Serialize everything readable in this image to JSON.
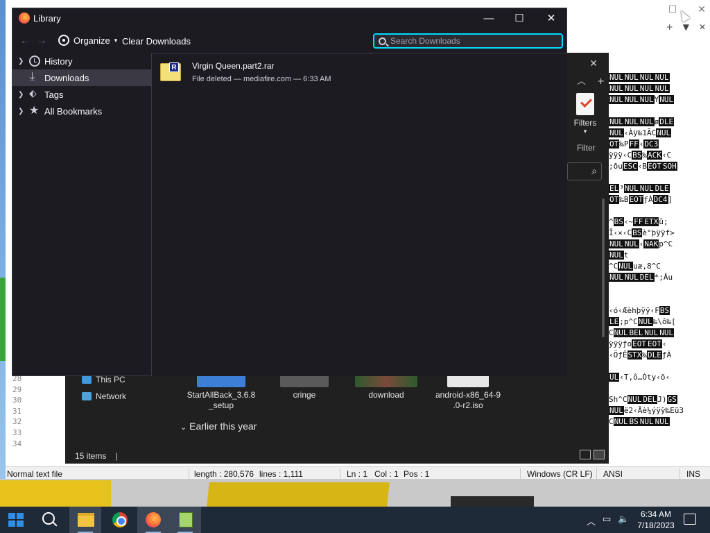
{
  "library": {
    "title": "Library",
    "organize_label": "Organize",
    "clear_downloads_label": "Clear Downloads",
    "search_placeholder": "Search Downloads",
    "sidebar": [
      {
        "label": "History",
        "expandable": true,
        "icon": "clock-icon"
      },
      {
        "label": "Downloads",
        "expandable": false,
        "icon": "download-icon",
        "selected": true
      },
      {
        "label": "Tags",
        "expandable": true,
        "icon": "tag-icon"
      },
      {
        "label": "All Bookmarks",
        "expandable": true,
        "icon": "star-icon"
      }
    ],
    "downloads": [
      {
        "name": "Virgin Queen.part2.rar",
        "status": "File deleted — mediafire.com — 6:33 AM",
        "icon": "rar-archive-icon"
      }
    ]
  },
  "explorer": {
    "filters_label": "Filters",
    "filter_label": "Filter",
    "nav": [
      {
        "label": "This PC",
        "icon": "computer-icon"
      },
      {
        "label": "Network",
        "icon": "network-icon"
      }
    ],
    "files": [
      {
        "name": "StartAllBack_3.6.8\n_setup"
      },
      {
        "name": "cringe"
      },
      {
        "name": "download"
      },
      {
        "name": "android-x86_64-9\n.0-r2.iso"
      }
    ],
    "group_label": "Earlier this year",
    "status": "15 items"
  },
  "notepadpp": {
    "line_numbers": [
      "28",
      "29",
      "30",
      "31",
      "32",
      "33",
      "34"
    ],
    "status": {
      "filetype": "Normal text file",
      "length": "length : 280,576",
      "lines": "lines : 1,111",
      "ln": "Ln : 1",
      "col": "Col : 1",
      "pos": "Pos : 1",
      "eol": "Windows (CR LF)",
      "encoding": "ANSI",
      "mode": "INS"
    }
  },
  "taskbar": {
    "time": "6:34 AM",
    "date": "7/18/2023"
  },
  "colors": {
    "library_bg": "#1c1b22",
    "accent": "#00ddff",
    "explorer_bg": "#202020",
    "taskbar_bg": "#1f2a38"
  }
}
